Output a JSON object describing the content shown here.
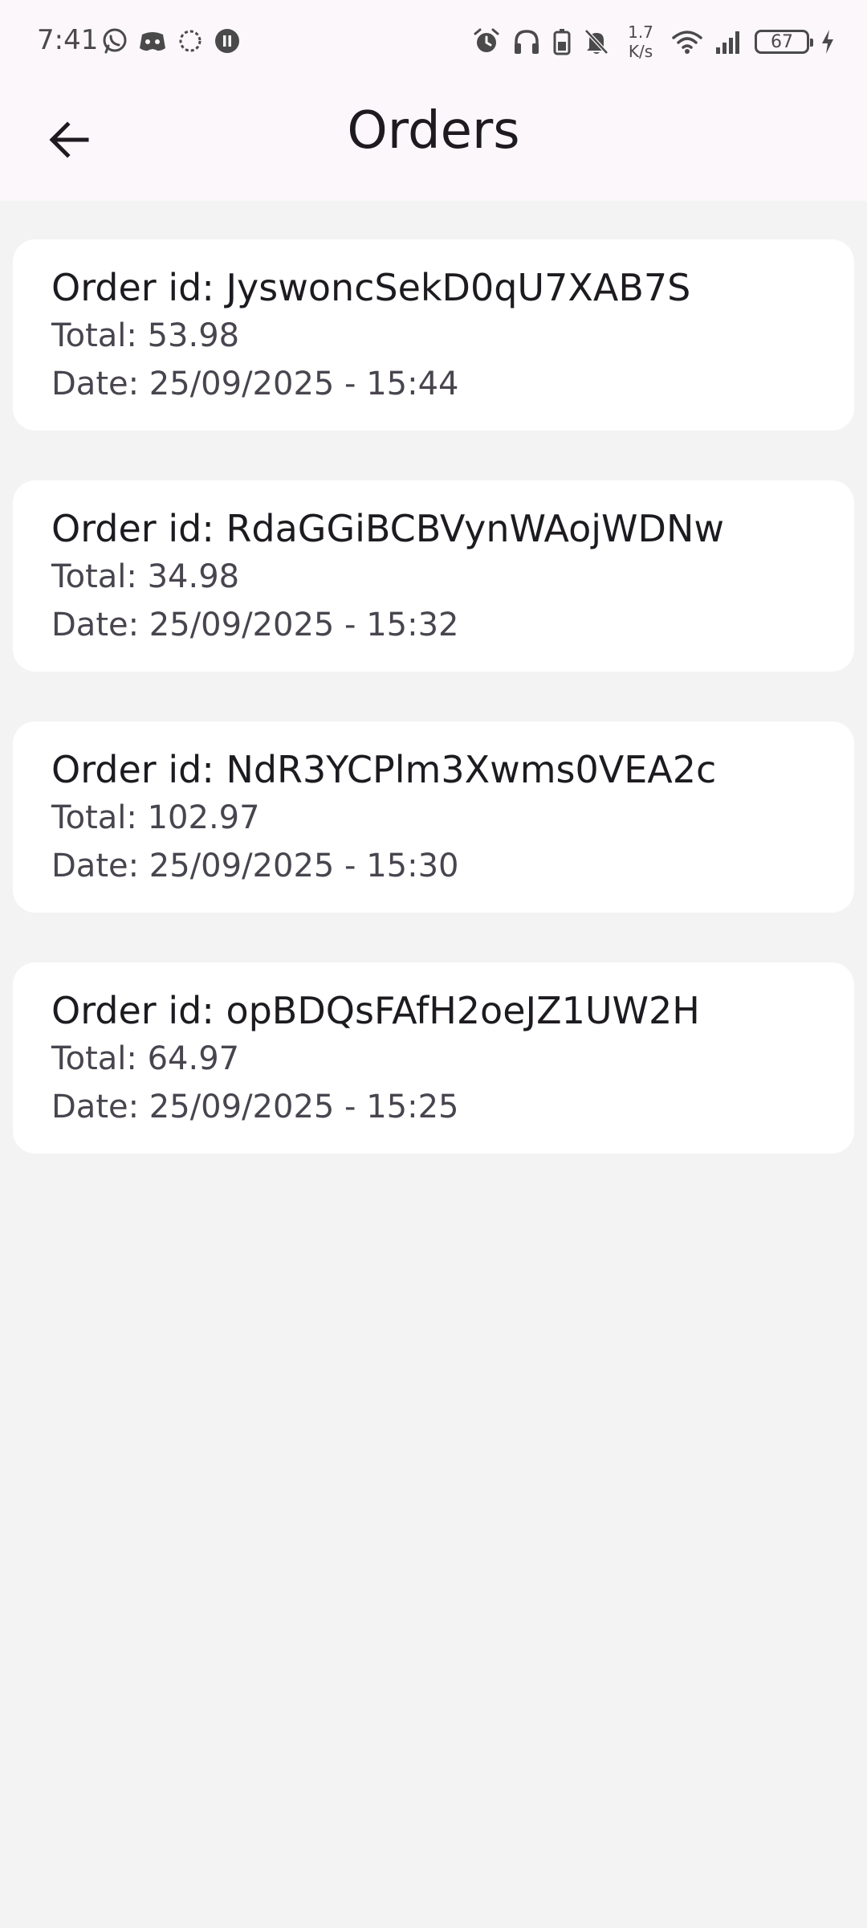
{
  "status_bar": {
    "time": "7:41",
    "net_speed_value": "1.7",
    "net_speed_unit": "K/s",
    "battery_level": "67",
    "left_icons": [
      "whatsapp-icon",
      "discord-icon",
      "sync-dashed-icon",
      "pause-circle-icon"
    ],
    "right_icons": [
      "alarm-icon",
      "headphones-icon",
      "battery-saver-icon",
      "bell-off-icon",
      "wifi-icon",
      "signal-icon",
      "charging-icon"
    ]
  },
  "header": {
    "title": "Orders",
    "back_icon": "arrow-back-icon"
  },
  "orders": [
    {
      "id_label": "Order id: JyswoncSekD0qU7XAB7S",
      "total_label": "Total: 53.98",
      "date_label": "Date: 25/09/2025 - 15:44"
    },
    {
      "id_label": "Order id: RdaGGiBCBVynWAojWDNw",
      "total_label": "Total: 34.98",
      "date_label": "Date: 25/09/2025 - 15:32"
    },
    {
      "id_label": "Order id: NdR3YCPlm3Xwms0VEA2c",
      "total_label": "Total: 102.97",
      "date_label": "Date: 25/09/2025 - 15:30"
    },
    {
      "id_label": "Order id: opBDQsFAfH2oeJZ1UW2H",
      "total_label": "Total: 64.97",
      "date_label": "Date: 25/09/2025 - 15:25"
    }
  ],
  "colors": {
    "app_bar_background": "#fcf7fb",
    "page_background": "#f3f3f3",
    "card_background": "#ffffff",
    "primary_text": "#1d1b20",
    "secondary_text": "#49454f"
  }
}
